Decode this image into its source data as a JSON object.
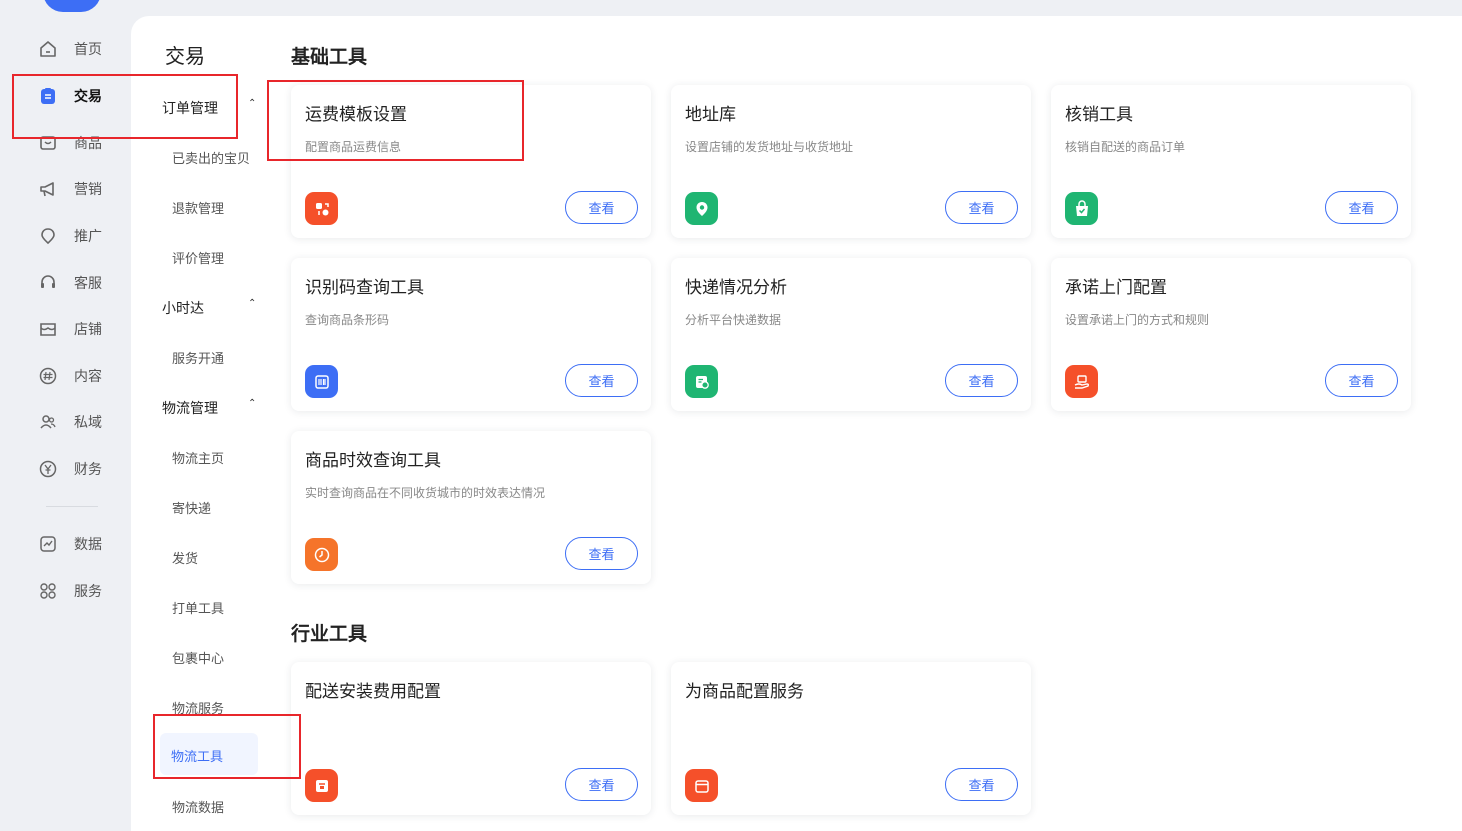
{
  "nav": {
    "items": [
      {
        "label": "首页",
        "icon": "home-icon"
      },
      {
        "label": "交易",
        "icon": "trade-icon"
      },
      {
        "label": "商品",
        "icon": "goods-icon"
      },
      {
        "label": "营销",
        "icon": "megaphone-icon"
      },
      {
        "label": "推广",
        "icon": "promote-icon"
      },
      {
        "label": "客服",
        "icon": "headset-icon"
      },
      {
        "label": "店铺",
        "icon": "shop-icon"
      },
      {
        "label": "内容",
        "icon": "hashtag-icon"
      },
      {
        "label": "私域",
        "icon": "users-icon"
      },
      {
        "label": "财务",
        "icon": "yuan-icon"
      },
      {
        "label": "数据",
        "icon": "chart-icon"
      },
      {
        "label": "服务",
        "icon": "apps-icon"
      }
    ],
    "active_index": 1
  },
  "submenu": {
    "title": "交易",
    "groups": [
      {
        "label": "订单管理",
        "items": [
          "已卖出的宝贝",
          "退款管理",
          "评价管理"
        ]
      },
      {
        "label": "小时达",
        "items": [
          "服务开通"
        ]
      },
      {
        "label": "物流管理",
        "items": [
          "物流主页",
          "寄快递",
          "发货",
          "打单工具",
          "包裹中心",
          "物流服务",
          "物流工具",
          "物流数据"
        ]
      }
    ],
    "active_item": "物流工具"
  },
  "sections": [
    {
      "title": "基础工具",
      "cards": [
        {
          "title": "运费模板设置",
          "desc": "配置商品运费信息",
          "button": "查看",
          "icon_color": "#f5502a",
          "icon": "freight-icon"
        },
        {
          "title": "地址库",
          "desc": "设置店铺的发货地址与收货地址",
          "button": "查看",
          "icon_color": "#1fb572",
          "icon": "location-icon"
        },
        {
          "title": "核销工具",
          "desc": "核销自配送的商品订单",
          "button": "查看",
          "icon_color": "#1fb572",
          "icon": "verify-bag-icon"
        },
        {
          "title": "识别码查询工具",
          "desc": "查询商品条形码",
          "button": "查看",
          "icon_color": "#3d6ef5",
          "icon": "barcode-scan-icon"
        },
        {
          "title": "快递情况分析",
          "desc": "分析平台快递数据",
          "button": "查看",
          "icon_color": "#1fb572",
          "icon": "express-analysis-icon"
        },
        {
          "title": "承诺上门配置",
          "desc": "设置承诺上门的方式和规则",
          "button": "查看",
          "icon_color": "#f5502a",
          "icon": "doorstep-icon"
        },
        {
          "title": "商品时效查询工具",
          "desc": "实时查询商品在不同收货城市的时效表达情况",
          "button": "查看",
          "icon_color": "#f5742a",
          "icon": "clock-icon"
        }
      ]
    },
    {
      "title": "行业工具",
      "cards": [
        {
          "title": "配送安装费用配置",
          "desc": "",
          "button": "查看",
          "icon_color": "#f5502a",
          "icon": "install-fee-icon"
        },
        {
          "title": "为商品配置服务",
          "desc": "",
          "button": "查看",
          "icon_color": "#f5502a",
          "icon": "service-box-icon"
        }
      ]
    }
  ],
  "colors": {
    "accent": "#3d6ef5",
    "annotation": "#e8262b"
  }
}
